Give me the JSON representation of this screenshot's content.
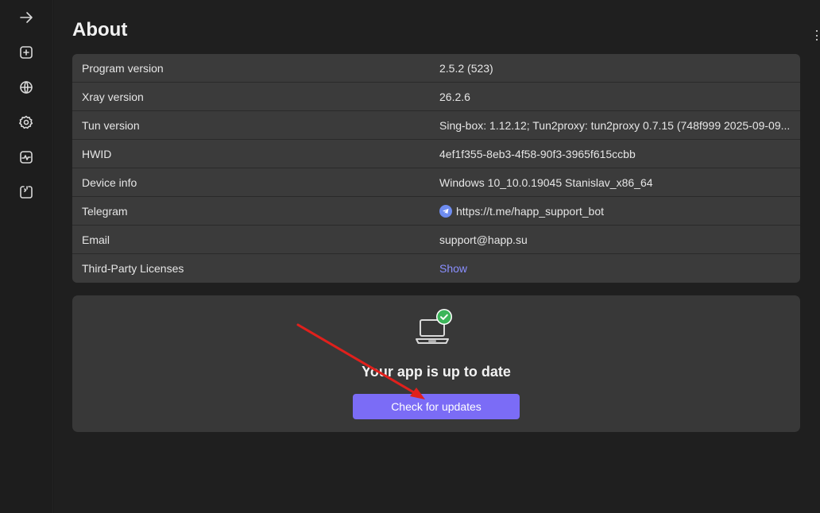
{
  "sidebar": {
    "items": [
      {
        "icon": "arrow-right-icon"
      },
      {
        "icon": "add-square-icon"
      },
      {
        "icon": "globe-icon"
      },
      {
        "icon": "gear-icon"
      },
      {
        "icon": "activity-monitor-icon"
      },
      {
        "icon": "logs-icon"
      }
    ]
  },
  "page": {
    "title": "About"
  },
  "info": {
    "rows": [
      {
        "label": "Program version",
        "value": "2.5.2 (523)"
      },
      {
        "label": "Xray version",
        "value": "26.2.6"
      },
      {
        "label": "Tun version",
        "value": "Sing-box: 1.12.12; Tun2proxy: tun2proxy 0.7.15 (748f999 2025-09-09..."
      },
      {
        "label": "HWID",
        "value": "4ef1f355-8eb3-4f58-90f3-3965f615ccbb"
      },
      {
        "label": "Device info",
        "value": "Windows 10_10.0.19045 Stanislav_x86_64"
      },
      {
        "label": "Telegram",
        "value": "https://t.me/happ_support_bot"
      },
      {
        "label": "Email",
        "value": "support@happ.su"
      },
      {
        "label": "Third-Party Licenses",
        "value": "Show"
      }
    ]
  },
  "update": {
    "status": "Your app is up to date",
    "button_label": "Check for updates"
  },
  "colors": {
    "accent": "#7b6cf6",
    "link": "#8a8fff",
    "success": "#3cb55a",
    "annotation": "#e0201c"
  }
}
